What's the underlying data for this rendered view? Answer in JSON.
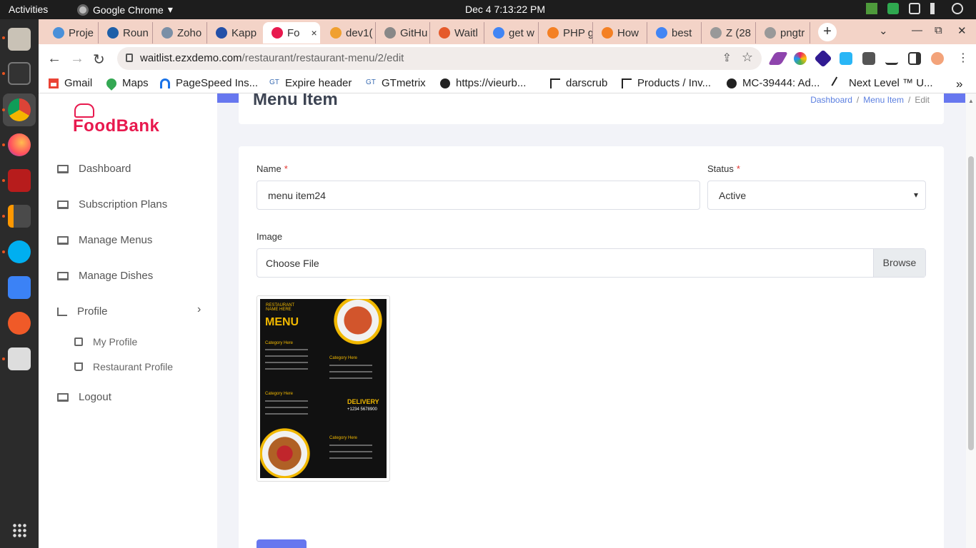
{
  "system": {
    "activities": "Activities",
    "app_name": "Google Chrome",
    "app_menu_arrow": "▾",
    "clock": "Dec 4   7:13:22 PM"
  },
  "tabs": [
    {
      "label": "Proje",
      "color": "#4a90d9"
    },
    {
      "label": "Roun",
      "color": "#1e5fa8"
    },
    {
      "label": "Zoho",
      "color": "#7b8fa6"
    },
    {
      "label": "Kapp",
      "color": "#2450a8"
    },
    {
      "label": "Fo",
      "color": "#e8194e"
    },
    {
      "label": "dev1(",
      "color": "#f0a030"
    },
    {
      "label": "GitHu",
      "color": "#888888"
    },
    {
      "label": "Waitl",
      "color": "#e55a2b"
    },
    {
      "label": "get w",
      "color": "#4285f4"
    },
    {
      "label": "PHP g",
      "color": "#f48024"
    },
    {
      "label": "How",
      "color": "#f48024"
    },
    {
      "label": "best",
      "color": "#4285f4"
    },
    {
      "label": "Z (28",
      "color": "#999999"
    },
    {
      "label": "pngtr",
      "color": "#999999"
    }
  ],
  "tab_close": "×",
  "new_tab": "+",
  "window_controls": {
    "dropdown": "⌄",
    "minimize": "—",
    "maximize": "⧉",
    "close": "✕"
  },
  "toolbar": {
    "back": "←",
    "forward": "→",
    "reload": "↻",
    "url_host": "waitlist.ezxdemo.com",
    "url_path": "/restaurant/restaurant-menu/2/edit",
    "share": "⇪",
    "star": "☆"
  },
  "bookmarks": [
    {
      "label": "Gmail",
      "color": "#ea4335"
    },
    {
      "label": "Maps",
      "color": "#34a853"
    },
    {
      "label": "PageSpeed Ins...",
      "color": "#1a73e8"
    },
    {
      "label": "Expire header",
      "color": "#3b6db3"
    },
    {
      "label": "GTmetrix",
      "color": "#3b6db3"
    },
    {
      "label": "https://vieurb...",
      "color": "#222222"
    },
    {
      "label": "darscrub",
      "color": "#222222"
    },
    {
      "label": "Products / Inv...",
      "color": "#222222"
    },
    {
      "label": "MC-39444: Ad...",
      "color": "#222222"
    },
    {
      "label": "Next Level ™ U...",
      "color": "#222222"
    }
  ],
  "bookmarks_more": "»",
  "brand": {
    "name": "FoodBank",
    "color": "#e8194e"
  },
  "sidebar": {
    "items": [
      {
        "label": "Dashboard"
      },
      {
        "label": "Subscription Plans"
      },
      {
        "label": "Manage Menus"
      },
      {
        "label": "Manage Dishes"
      },
      {
        "label": "Profile"
      },
      {
        "label": "Logout"
      }
    ],
    "profile_chevron": "›",
    "sub_items": [
      {
        "label": "My Profile"
      },
      {
        "label": "Restaurant Profile"
      }
    ]
  },
  "page": {
    "title": "Menu Item",
    "breadcrumb": [
      "Dashboard",
      "/",
      "Menu Item",
      "/",
      "Edit"
    ]
  },
  "form": {
    "name_label": "Name",
    "required_mark": "*",
    "name_value": "menu item24",
    "status_label": "Status",
    "status_value": "Active",
    "select_arrow": "▾",
    "image_label": "Image",
    "file_placeholder": "Choose File",
    "browse_label": "Browse"
  },
  "preview_image": {
    "heading": "MENU",
    "restaurant_name": "RESTAURANT NAME HERE",
    "category": "Category Here",
    "delivery": "DELIVERY",
    "phone": "+1234 5678900"
  },
  "colors": {
    "accent": "#6777ef",
    "brand": "#e8194e",
    "tab_strip": "#f3d3c7"
  }
}
